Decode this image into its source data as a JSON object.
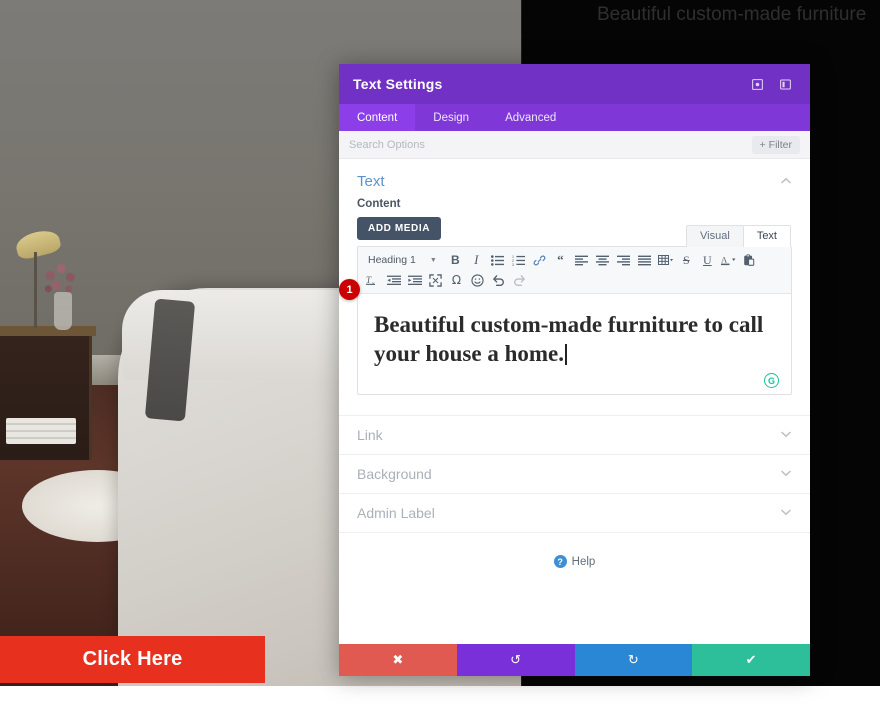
{
  "page": {
    "hero_heading": "Beautiful custom-made furniture",
    "cta_label": "Click Here",
    "photo_alt": "bedroom-photo"
  },
  "modal": {
    "title": "Text Settings",
    "header_icons": [
      {
        "name": "expand-icon"
      },
      {
        "name": "panel-layout-icon"
      }
    ],
    "tabs": [
      {
        "label": "Content",
        "active": true
      },
      {
        "label": "Design",
        "active": false
      },
      {
        "label": "Advanced",
        "active": false
      }
    ],
    "search": {
      "placeholder": "Search Options",
      "value": ""
    },
    "filter_label": "Filter",
    "filter_plus": "+"
  },
  "text_section": {
    "title": "Text",
    "chevron": "up",
    "content_label": "Content",
    "add_media_label": "ADD MEDIA",
    "editor_tabs": [
      {
        "label": "Visual",
        "active": false
      },
      {
        "label": "Text",
        "active": true
      }
    ],
    "format_select": "Heading 1",
    "toolbar_row1": [
      "bold-icon",
      "italic-icon",
      "bulleted-list-icon",
      "numbered-list-icon",
      "link-icon",
      "blockquote-icon",
      "align-left-icon",
      "align-center-icon",
      "align-right-icon",
      "align-justify-icon",
      "table-icon",
      "strikethrough-icon",
      "underline-icon",
      "text-color-icon",
      "paste-icon"
    ],
    "toolbar_row2": [
      "clear-formatting-icon",
      "outdent-icon",
      "indent-icon",
      "fullscreen-icon",
      "special-character-icon",
      "emoji-icon",
      "undo-icon",
      "redo-icon"
    ],
    "editor_content": "Beautiful custom-made furniture to call your house a home.",
    "grammarly_letter": "G",
    "step_badge": "1"
  },
  "sections": [
    {
      "title": "Link",
      "chevron": "down"
    },
    {
      "title": "Background",
      "chevron": "down"
    },
    {
      "title": "Admin Label",
      "chevron": "down"
    }
  ],
  "help": {
    "label": "Help",
    "icon_char": "?"
  },
  "footer": {
    "buttons": [
      {
        "name": "cancel-button",
        "glyph": "✖",
        "color": "#e05a52"
      },
      {
        "name": "undo-button",
        "glyph": "↺",
        "color": "#7a30d8"
      },
      {
        "name": "redo-button",
        "glyph": "↻",
        "color": "#2a87d6"
      },
      {
        "name": "save-button",
        "glyph": "✔",
        "color": "#2cbf9a"
      }
    ]
  },
  "colors": {
    "modal_header": "#7031c4",
    "modal_tabs": "#7f37d8",
    "accent_red": "#cc0000",
    "cta_red": "#e8301f",
    "save_teal": "#2cbf9a"
  }
}
